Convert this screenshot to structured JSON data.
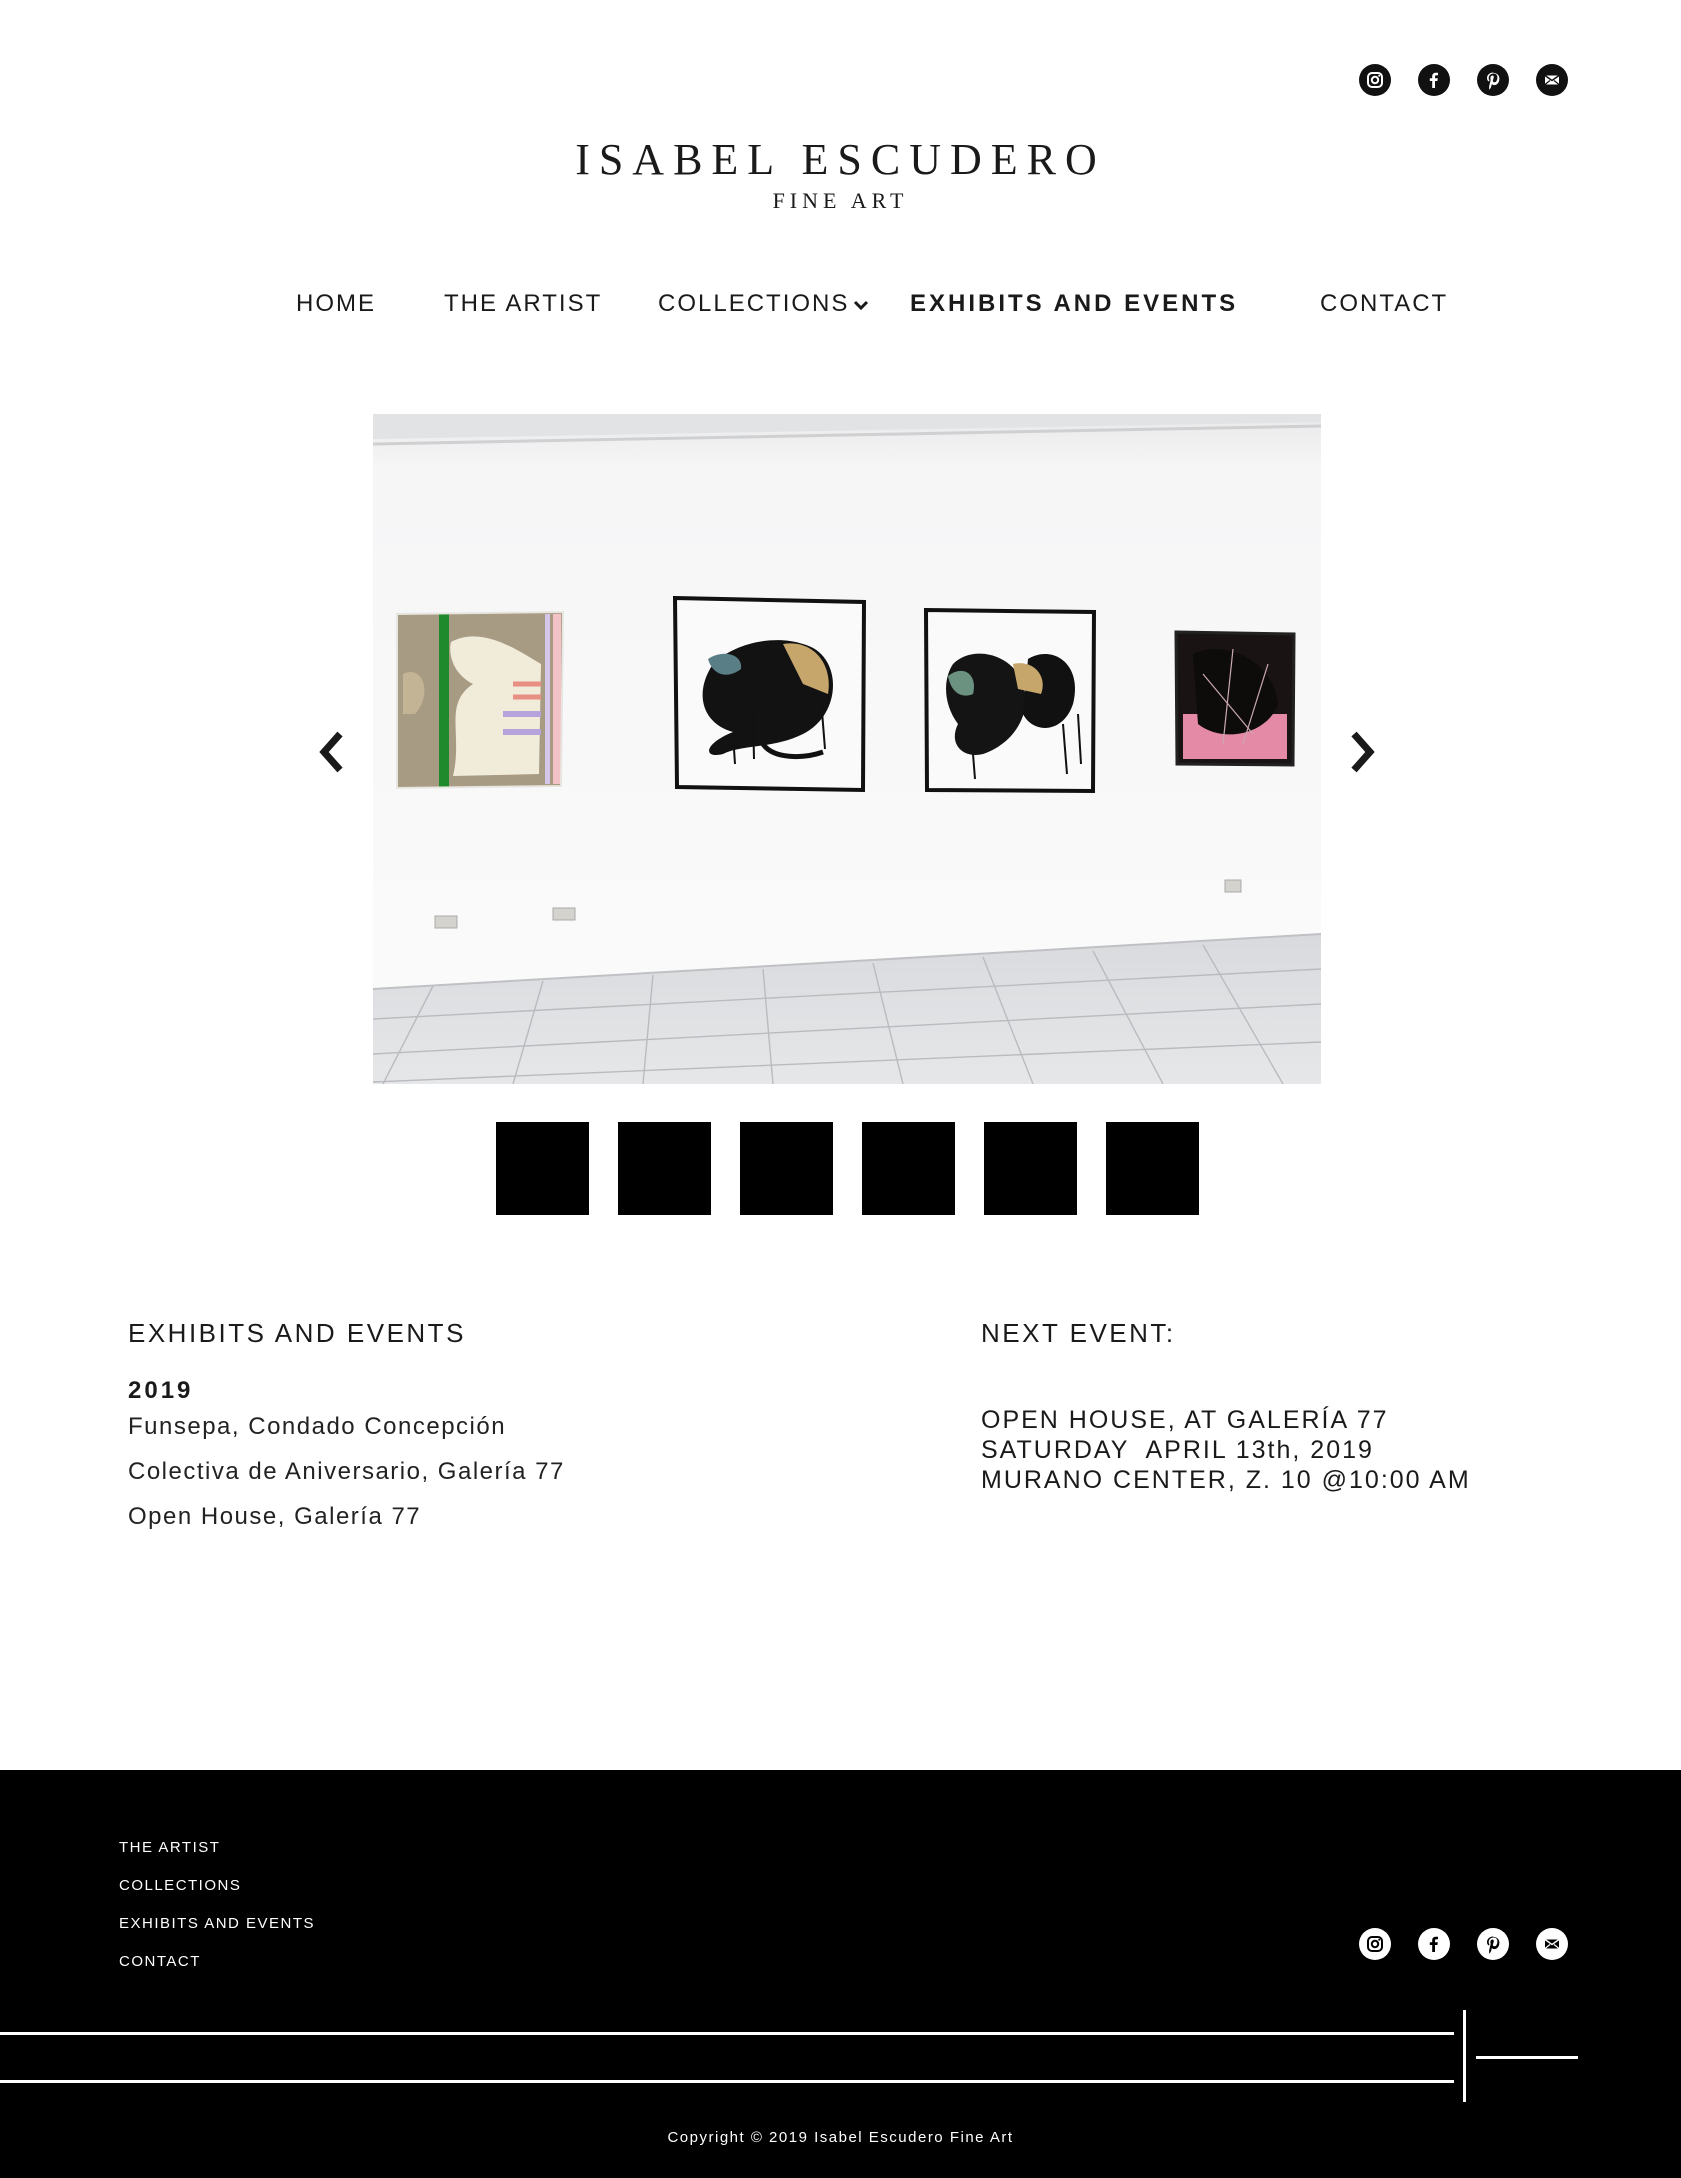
{
  "brand": {
    "name": "ISABEL ESCUDERO",
    "subtitle": "FINE ART"
  },
  "social": {
    "icons": [
      "instagram-icon",
      "facebook-icon",
      "pinterest-icon",
      "email-icon"
    ]
  },
  "nav": {
    "items": [
      {
        "label": "HOME"
      },
      {
        "label": "THE ARTIST"
      },
      {
        "label": "COLLECTIONS"
      },
      {
        "label": "EXHIBITS AND EVENTS"
      },
      {
        "label": "CONTACT"
      }
    ],
    "active": "EXHIBITS AND EVENTS"
  },
  "slider": {
    "thumbnail_count": 6
  },
  "exhibits": {
    "title": "EXHIBITS AND EVENTS",
    "year": "2019",
    "events": [
      "Funsepa, Condado Concepción",
      "Colectiva de Aniversario, Galería 77",
      "Open House, Galería 77"
    ]
  },
  "next_event": {
    "title": "NEXT EVENT:",
    "lines": [
      "OPEN HOUSE, AT GALERÍA 77",
      "SATURDAY  APRIL 13th, 2019",
      "MURANO CENTER, Z. 10 @10:00 AM"
    ]
  },
  "footer": {
    "links": [
      "THE ARTIST",
      "COLLECTIONS",
      "EXHIBITS AND EVENTS",
      "CONTACT"
    ],
    "copyright": "Copyright © 2019 Isabel Escudero Fine Art"
  },
  "colors": {
    "text": "#1a1a1a",
    "background": "#ffffff",
    "footer": "#000000"
  }
}
